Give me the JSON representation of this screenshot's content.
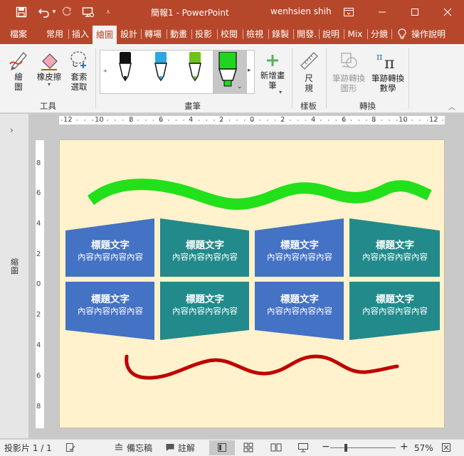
{
  "titlebar": {
    "doc_title": "簡報1  -  PowerPoint",
    "user": "wenhsien shih",
    "icons": [
      "save-icon",
      "undo-icon",
      "redo-icon",
      "present-from-start-icon",
      "customize-qat-icon",
      "ribbon-display-icon",
      "minimize-icon",
      "maximize-icon",
      "close-icon"
    ]
  },
  "tabs": [
    {
      "label": "檔案"
    },
    {
      "label": "常用"
    },
    {
      "label": "插入"
    },
    {
      "label": "繪圖"
    },
    {
      "label": "設計"
    },
    {
      "label": "轉場"
    },
    {
      "label": "動畫"
    },
    {
      "label": "投影"
    },
    {
      "label": "校閱"
    },
    {
      "label": "檢視"
    },
    {
      "label": "錄製"
    },
    {
      "label": "開發."
    },
    {
      "label": "說明"
    },
    {
      "label": "Mix"
    },
    {
      "label": "分鏡"
    },
    {
      "label": "操作說明"
    }
  ],
  "active_tab": "繪圖",
  "ribbon": {
    "draw": "繪\n圖",
    "eraser": "橡皮擦",
    "lasso": "套索\n選取",
    "group_tools": "工具",
    "pens": [
      {
        "name": "black-pen",
        "color": "#111111"
      },
      {
        "name": "blue-pen",
        "color": "#2aa8e0"
      },
      {
        "name": "green-pen",
        "color": "#6fc21a"
      },
      {
        "name": "green-highlighter",
        "color": "#22d41f"
      }
    ],
    "group_pens": "畫筆",
    "add_pen": "新增畫\n筆",
    "ruler": "尺\n規",
    "group_stencils": "樣板",
    "ink_to_shape": "筆跡轉換\n圖形",
    "ink_to_math": "筆跡轉換\n數學",
    "group_convert": "轉換"
  },
  "left_pane": {
    "label": "縮圖"
  },
  "ruler": {
    "h_ticks": [
      "12",
      "10",
      "8",
      "6",
      "4",
      "2",
      "0",
      "2",
      "4",
      "6",
      "8",
      "10",
      "12"
    ],
    "v_ticks": [
      "8",
      "6",
      "4",
      "2",
      "0",
      "2",
      "4",
      "6",
      "8"
    ]
  },
  "slide": {
    "background": "#fff2cc",
    "cards": [
      {
        "title": "標題文字",
        "body": "內容內容內容內容",
        "color": "#4472c4"
      },
      {
        "title": "標題文字",
        "body": "內容內容內容內容",
        "color": "#238a8b"
      },
      {
        "title": "標題文字",
        "body": "內容內容內容內容",
        "color": "#4472c4"
      },
      {
        "title": "標題文字",
        "body": "內容內容內容內容",
        "color": "#238a8b"
      },
      {
        "title": "標題文字",
        "body": "內容內容內容內容",
        "color": "#4472c4"
      },
      {
        "title": "標題文字",
        "body": "內容內容內容內容",
        "color": "#238a8b"
      },
      {
        "title": "標題文字",
        "body": "內容內容內容內容",
        "color": "#4472c4"
      },
      {
        "title": "標題文字",
        "body": "內容內容內容內容",
        "color": "#238a8b"
      }
    ],
    "ink_top_color": "#22e01a",
    "ink_bottom_color": "#c00000"
  },
  "status": {
    "slide_num": "投影片 1 / 1",
    "notes": "備忘稿",
    "comments": "註解",
    "zoom": "57%"
  },
  "colors": {
    "accent": "#b7472a"
  }
}
